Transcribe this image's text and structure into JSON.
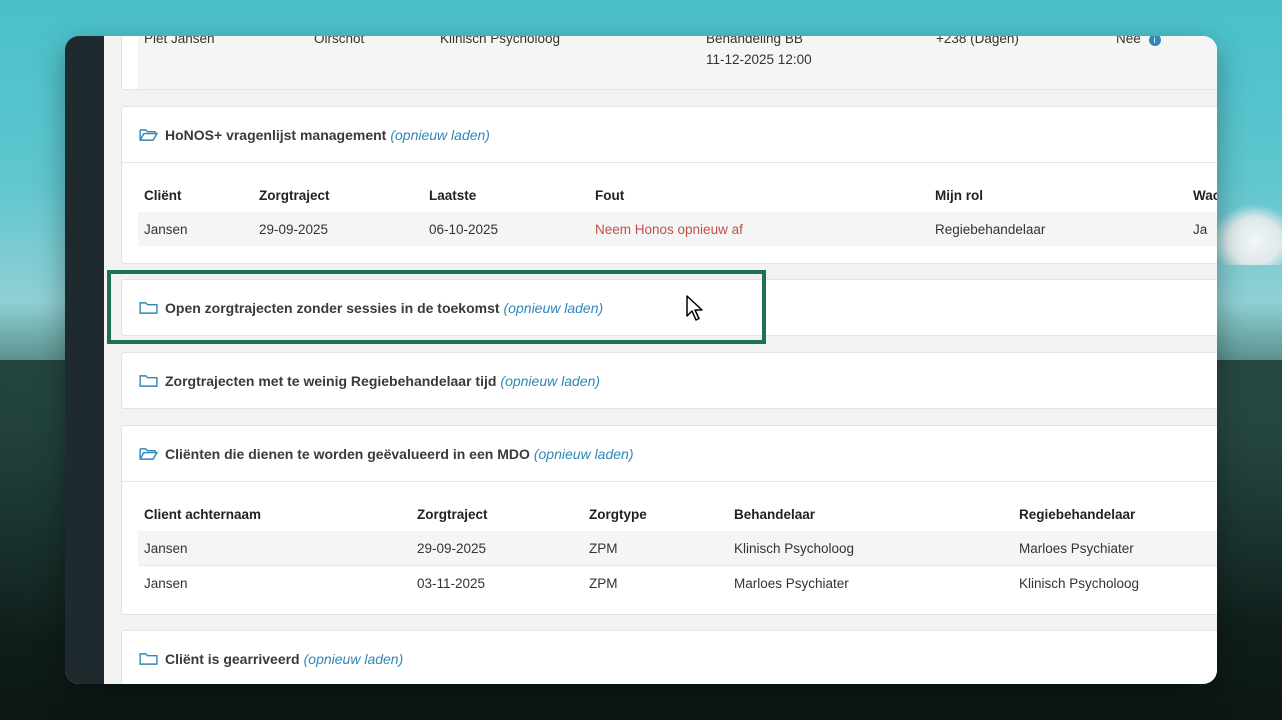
{
  "top_row": {
    "client": "Piet Jansen",
    "location": "Oirschot",
    "role": "Klinisch Psycholoog",
    "activity": "Behandeling BB",
    "datetime": "11-12-2025 12:00",
    "days": "+238 (Dagen)",
    "flag": "Nee"
  },
  "honos": {
    "title": "HoNOS+ vragenlijst management",
    "reload": "(opnieuw laden)",
    "columns": [
      "Cliënt",
      "Zorgtraject",
      "Laatste",
      "Fout",
      "Mijn rol",
      "Wac"
    ],
    "rows": [
      [
        "Jansen",
        "29-09-2025",
        "06-10-2025",
        "Neem Honos opnieuw af",
        "Regiebehandelaar",
        "Ja"
      ]
    ]
  },
  "open_trajecten": {
    "title": "Open zorgtrajecten zonder sessies in de toekomst",
    "reload": "(opnieuw laden)"
  },
  "weinig_tijd": {
    "title": "Zorgtrajecten met te weinig Regiebehandelaar tijd",
    "reload": "(opnieuw laden)"
  },
  "mdo": {
    "title": "Cliënten die dienen te worden geëvalueerd in een MDO",
    "reload": "(opnieuw laden)",
    "columns": [
      "Client achternaam",
      "Zorgtraject",
      "Zorgtype",
      "Behandelaar",
      "Regiebehandelaar"
    ],
    "rows": [
      [
        "Jansen",
        "29-09-2025",
        "ZPM",
        "Klinisch Psycholoog",
        "Marloes Psychiater"
      ],
      [
        "Jansen",
        "03-11-2025",
        "ZPM",
        "Marloes Psychiater",
        "Klinisch Psycholoog"
      ]
    ]
  },
  "gearriveerd": {
    "title": "Cliënt is gearriveerd",
    "reload": "(opnieuw laden)"
  },
  "colors": {
    "accent_link": "#2f86b8",
    "error_text": "#c0504d",
    "highlight_border": "#1f7055"
  }
}
